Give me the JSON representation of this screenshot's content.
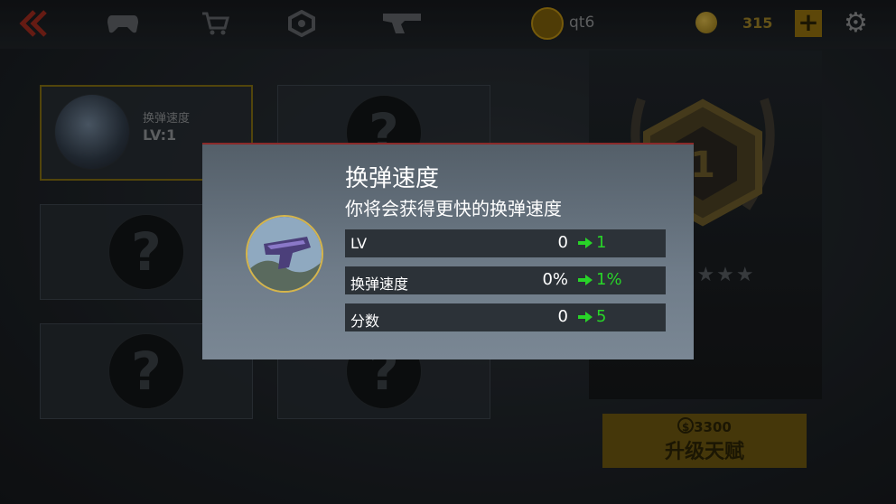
{
  "topbar": {
    "icons": [
      "back-chevron-icon",
      "gamepad-icon",
      "cart-icon",
      "badge-icon",
      "pistol-icon"
    ],
    "username": "qt6",
    "coins": "315",
    "plus_label": "+",
    "settings_icon": "gear-icon"
  },
  "talent_slots": [
    {
      "title": "换弹速度",
      "level": "LV:1",
      "unlocked": true
    },
    {
      "locked_glyph": "?"
    },
    {
      "locked_glyph": "?"
    },
    {
      "locked_glyph": "?"
    },
    {
      "locked_glyph": "?"
    },
    {
      "locked_glyph": "?"
    }
  ],
  "rank_panel": {
    "rank_number": "1",
    "stars": "★★★★★"
  },
  "upgrade": {
    "price": "3300",
    "currency_symbol": "$",
    "label": "升级天赋"
  },
  "modal": {
    "title": "换弹速度",
    "description": "你将会获得更快的换弹速度",
    "rows": [
      {
        "label": "LV",
        "old": "0",
        "new": "1"
      },
      {
        "label": "换弹速度",
        "old": "0%",
        "new": "1%"
      },
      {
        "label": "分数",
        "old": "0",
        "new": "5"
      }
    ]
  },
  "colors": {
    "accent_gold": "#b48a12",
    "increase_green": "#28d428",
    "modal_top_border": "#8a2a2a"
  }
}
